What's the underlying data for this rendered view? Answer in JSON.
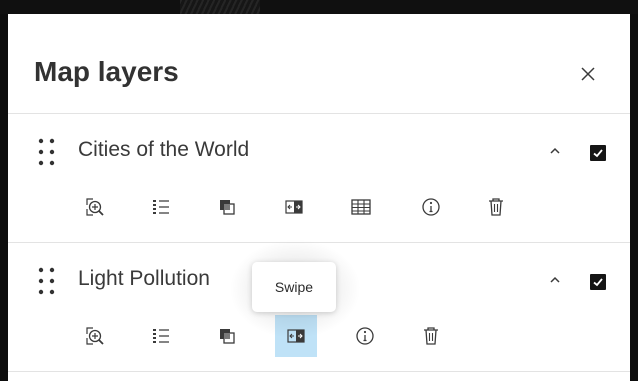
{
  "panel": {
    "title": "Map layers",
    "close_icon": "close-icon"
  },
  "layers": [
    {
      "name": "Cities of the World",
      "visible": true,
      "expanded": true,
      "tools": [
        "zoom-to-icon",
        "legend-icon",
        "transparency-icon",
        "swipe-icon",
        "attribute-table-icon",
        "information-icon",
        "trash-icon"
      ]
    },
    {
      "name": "Light Pollution",
      "visible": true,
      "expanded": true,
      "tools": [
        "zoom-to-icon",
        "legend-icon",
        "transparency-icon",
        "swipe-icon",
        "information-icon",
        "trash-icon"
      ],
      "active_tool": "swipe-icon"
    }
  ],
  "tooltip": {
    "text": "Swipe"
  },
  "colors": {
    "panel_bg": "#ffffff",
    "title_text": "#323232",
    "checkbox": "#151515",
    "active_tool_bg": "#bfe2f7",
    "divider": "#e3e3e3"
  }
}
